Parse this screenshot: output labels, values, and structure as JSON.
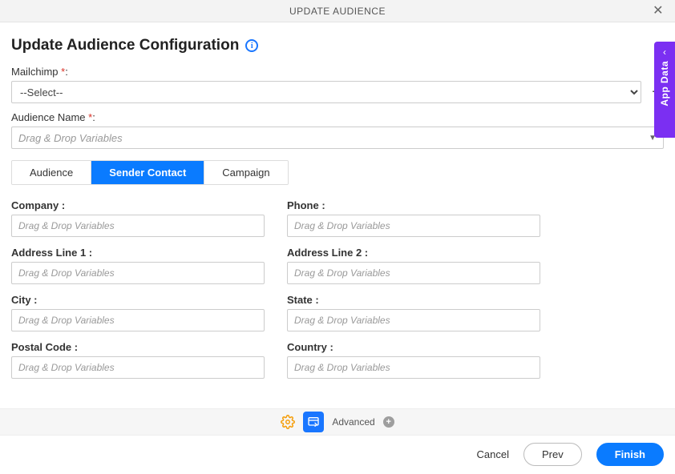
{
  "titlebar": {
    "title": "UPDATE AUDIENCE"
  },
  "heading": "Update Audience Configuration",
  "side_tab": {
    "label": "App Data"
  },
  "mailchimp": {
    "label": "Mailchimp",
    "selected": "--Select--"
  },
  "audience_name": {
    "label": "Audience Name",
    "placeholder": "Drag & Drop Variables"
  },
  "tabs": {
    "audience": "Audience",
    "sender_contact": "Sender Contact",
    "campaign": "Campaign",
    "active": "sender_contact"
  },
  "fields": {
    "company": {
      "label": "Company :",
      "placeholder": "Drag & Drop Variables"
    },
    "phone": {
      "label": "Phone :",
      "placeholder": "Drag & Drop Variables"
    },
    "address_line_1": {
      "label": "Address Line 1 :",
      "placeholder": "Drag & Drop Variables"
    },
    "address_line_2": {
      "label": "Address Line 2 :",
      "placeholder": "Drag & Drop Variables"
    },
    "city": {
      "label": "City :",
      "placeholder": "Drag & Drop Variables"
    },
    "state": {
      "label": "State :",
      "placeholder": "Drag & Drop Variables"
    },
    "postal_code": {
      "label": "Postal Code :",
      "placeholder": "Drag & Drop Variables"
    },
    "country": {
      "label": "Country :",
      "placeholder": "Drag & Drop Variables"
    }
  },
  "footer": {
    "advanced_label": "Advanced"
  },
  "actions": {
    "cancel": "Cancel",
    "prev": "Prev",
    "finish": "Finish"
  }
}
